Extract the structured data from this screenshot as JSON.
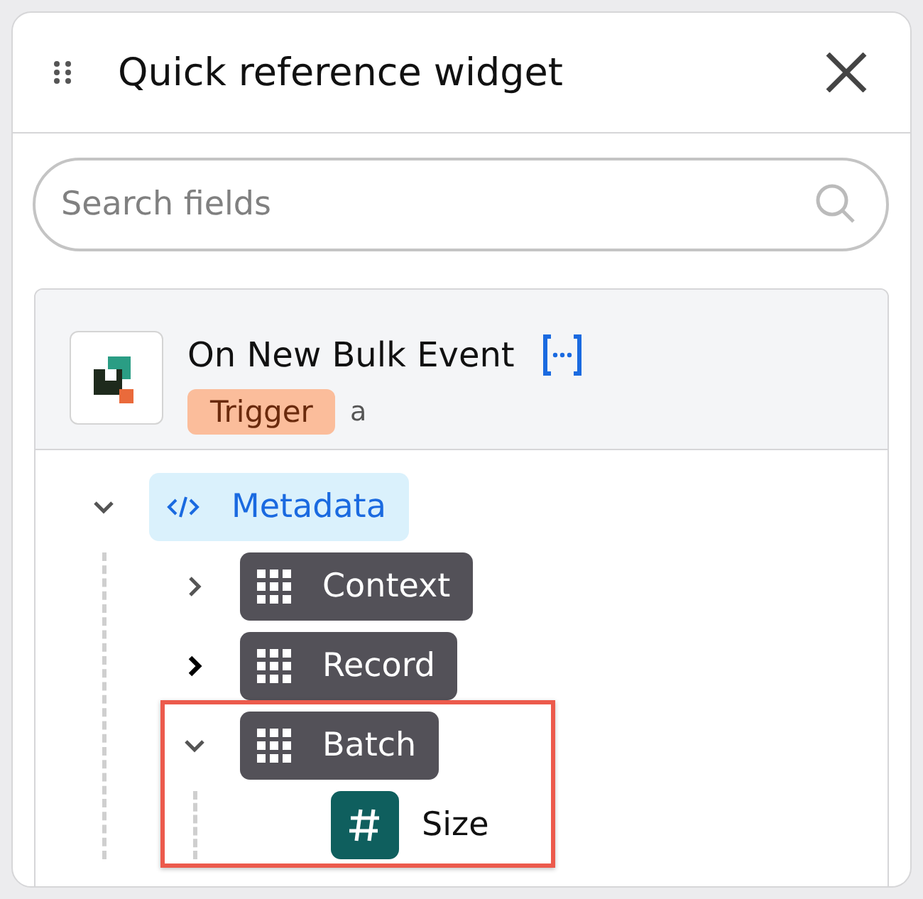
{
  "widget": {
    "title": "Quick reference widget"
  },
  "search": {
    "placeholder": "Search fields"
  },
  "source": {
    "name": "On New Bulk Event",
    "badge": "Trigger",
    "suffix": "a"
  },
  "tree": [
    {
      "label": "Metadata",
      "kind": "code",
      "expanded": true,
      "hovered": false,
      "highlighted": false,
      "children": [
        {
          "label": "Context",
          "kind": "object",
          "expanded": false,
          "hovered": false,
          "highlighted": false
        },
        {
          "label": "Record",
          "kind": "object",
          "expanded": false,
          "hovered": true,
          "highlighted": false
        },
        {
          "label": "Batch",
          "kind": "object",
          "expanded": true,
          "hovered": false,
          "highlighted": true,
          "children": [
            {
              "label": "Size",
              "kind": "number",
              "highlighted": false
            }
          ]
        }
      ]
    }
  ]
}
